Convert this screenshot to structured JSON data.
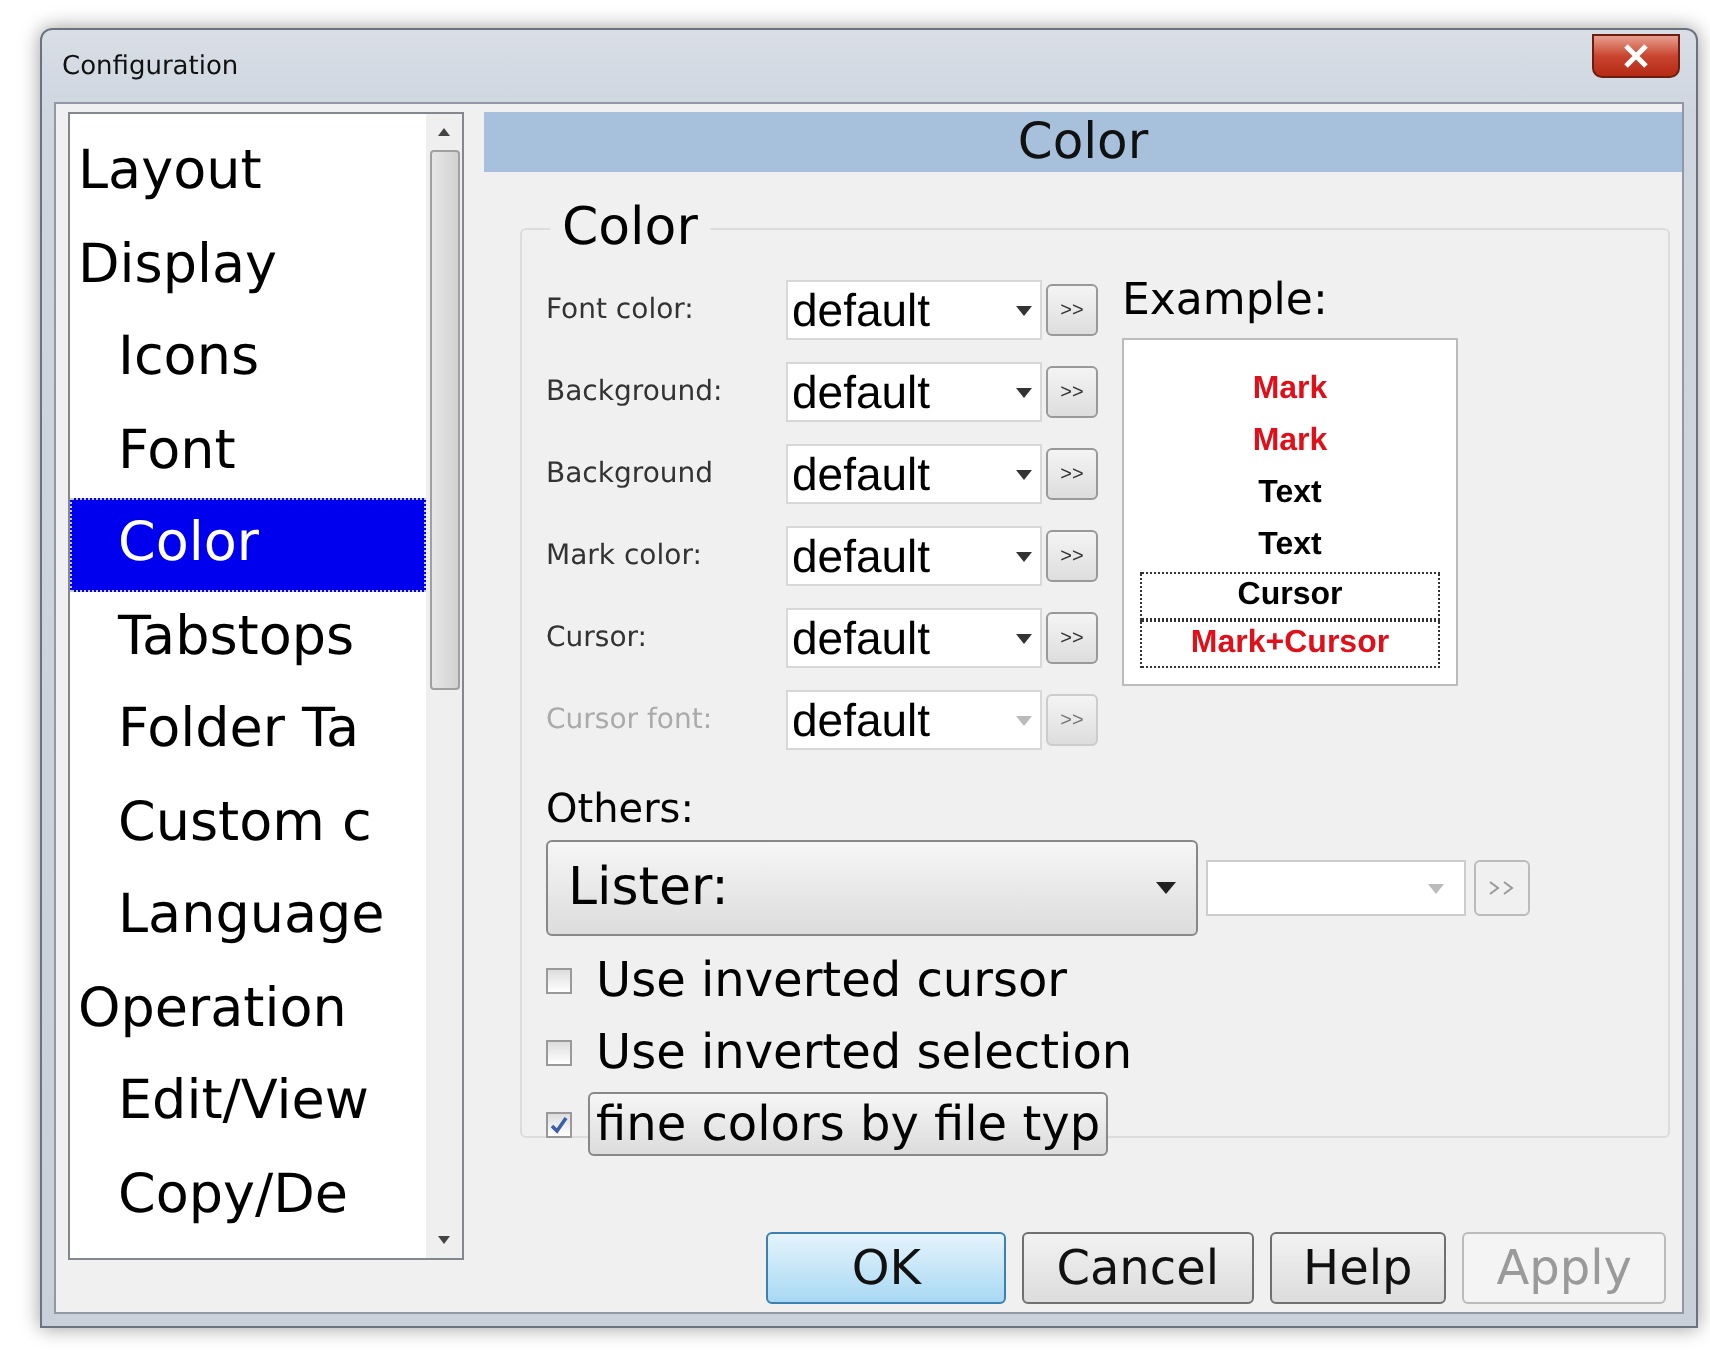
{
  "window": {
    "title": "Configuration"
  },
  "sidebar": {
    "items": [
      {
        "label": "Layout",
        "selected": false
      },
      {
        "label": "Display",
        "selected": false,
        "children": [
          {
            "label": "Icons",
            "selected": false
          },
          {
            "label": "Font",
            "selected": false
          },
          {
            "label": "Color",
            "selected": true
          },
          {
            "label": "Tabstops",
            "selected": false
          },
          {
            "label": "Folder Ta",
            "selected": false
          },
          {
            "label": "Custom c",
            "selected": false
          },
          {
            "label": "Language",
            "selected": false
          }
        ]
      },
      {
        "label": "Operation",
        "selected": false,
        "children": [
          {
            "label": "Edit/View",
            "selected": false
          },
          {
            "label": "Copy/De",
            "selected": false
          }
        ]
      }
    ]
  },
  "panel": {
    "header": "Color",
    "group_title": "Color",
    "color_rows": [
      {
        "label": "Font color:",
        "value": "default",
        "disabled": false
      },
      {
        "label": "Background:",
        "value": "default",
        "disabled": false
      },
      {
        "label": "Background",
        "value": "default",
        "disabled": false
      },
      {
        "label": "Mark color:",
        "value": "default",
        "disabled": false
      },
      {
        "label": "Cursor:",
        "value": "default",
        "disabled": false
      },
      {
        "label": "Cursor font:",
        "value": "default",
        "disabled": true
      }
    ],
    "picker_label": ">>",
    "example": {
      "label": "Example:",
      "lines": [
        {
          "text": "Mark",
          "color": "#e0101a",
          "cursor": false
        },
        {
          "text": "Mark",
          "color": "#e0101a",
          "cursor": false
        },
        {
          "text": "Text",
          "color": "#000000",
          "cursor": false
        },
        {
          "text": "Text",
          "color": "#000000",
          "cursor": false
        },
        {
          "text": "Cursor",
          "color": "#000000",
          "cursor": true
        },
        {
          "text": "Mark+Cursor",
          "color": "#e0101a",
          "cursor": true
        }
      ]
    },
    "others": {
      "label": "Others:",
      "dropdown": "Lister:"
    },
    "checkboxes": [
      {
        "label": "Use inverted cursor",
        "checked": false,
        "focused": false
      },
      {
        "label": "Use inverted selection",
        "checked": false,
        "focused": false
      },
      {
        "label": "fine colors by file typ",
        "checked": true,
        "focused": true
      }
    ]
  },
  "buttons": [
    {
      "label": "OK",
      "default": true,
      "disabled": false
    },
    {
      "label": "Cancel",
      "default": false,
      "disabled": false
    },
    {
      "label": "Help",
      "default": false,
      "disabled": false
    },
    {
      "label": "Apply",
      "default": false,
      "disabled": true
    }
  ]
}
